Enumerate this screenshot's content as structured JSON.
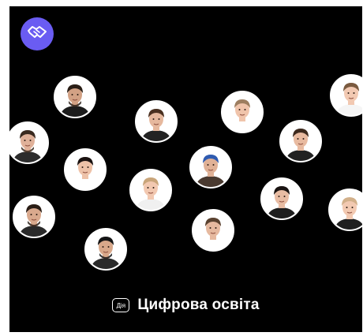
{
  "brand": {
    "badge_text": "Дія",
    "title": "Цифрова освіта",
    "logo_color": "#6a5cf2",
    "logo_icon": "handshake-icon"
  },
  "avatars": [
    {
      "hair": "#2a1e16",
      "skin": "#d2a184",
      "shirt": "#1c1c1c",
      "beard": true
    },
    {
      "hair": "#3a2a1f",
      "skin": "#e0b199",
      "shirt": "#2c2c2c",
      "beard": true
    },
    {
      "hair": "#4a3020",
      "skin": "#e6b89d",
      "shirt": "#222222",
      "beard": false
    },
    {
      "hair": "#9d7e60",
      "skin": "#f0c4ab",
      "shirt": "#ffffff",
      "beard": false
    },
    {
      "hair": "#7a5a3f",
      "skin": "#f2c9b2",
      "shirt": "#f5f5f5",
      "beard": false
    },
    {
      "hair": "#3d2a1e",
      "skin": "#e8baa0",
      "shirt": "#222222",
      "beard": false
    },
    {
      "hair": "#1a1210",
      "skin": "#eec2a8",
      "shirt": "#ffffff",
      "beard": false
    },
    {
      "hair": "#c9a57a",
      "skin": "#f2c8b0",
      "shirt": "#f0f0f0",
      "beard": false
    },
    {
      "hair": "#2f5bb0",
      "skin": "#e0b196",
      "shirt": "#4a3a30",
      "beard": false
    },
    {
      "hair": "#2a1d15",
      "skin": "#d9a98d",
      "shirt": "#2a2a2a",
      "beard": true
    },
    {
      "hair": "#5a4230",
      "skin": "#e6b99f",
      "shirt": "#ffffff",
      "beard": false
    },
    {
      "hair": "#1a1412",
      "skin": "#e8bca3",
      "shirt": "#1e1e1e",
      "beard": false
    },
    {
      "hair": "#d2b08a",
      "skin": "#f2c9b1",
      "shirt": "#1f1f1f",
      "beard": false
    },
    {
      "hair": "#151515",
      "skin": "#d8a88a",
      "shirt": "#2a2a2a",
      "beard": true
    },
    {
      "hair": "#6b4b33",
      "skin": "#ebbea4",
      "shirt": "#ffffff",
      "beard": false
    }
  ]
}
